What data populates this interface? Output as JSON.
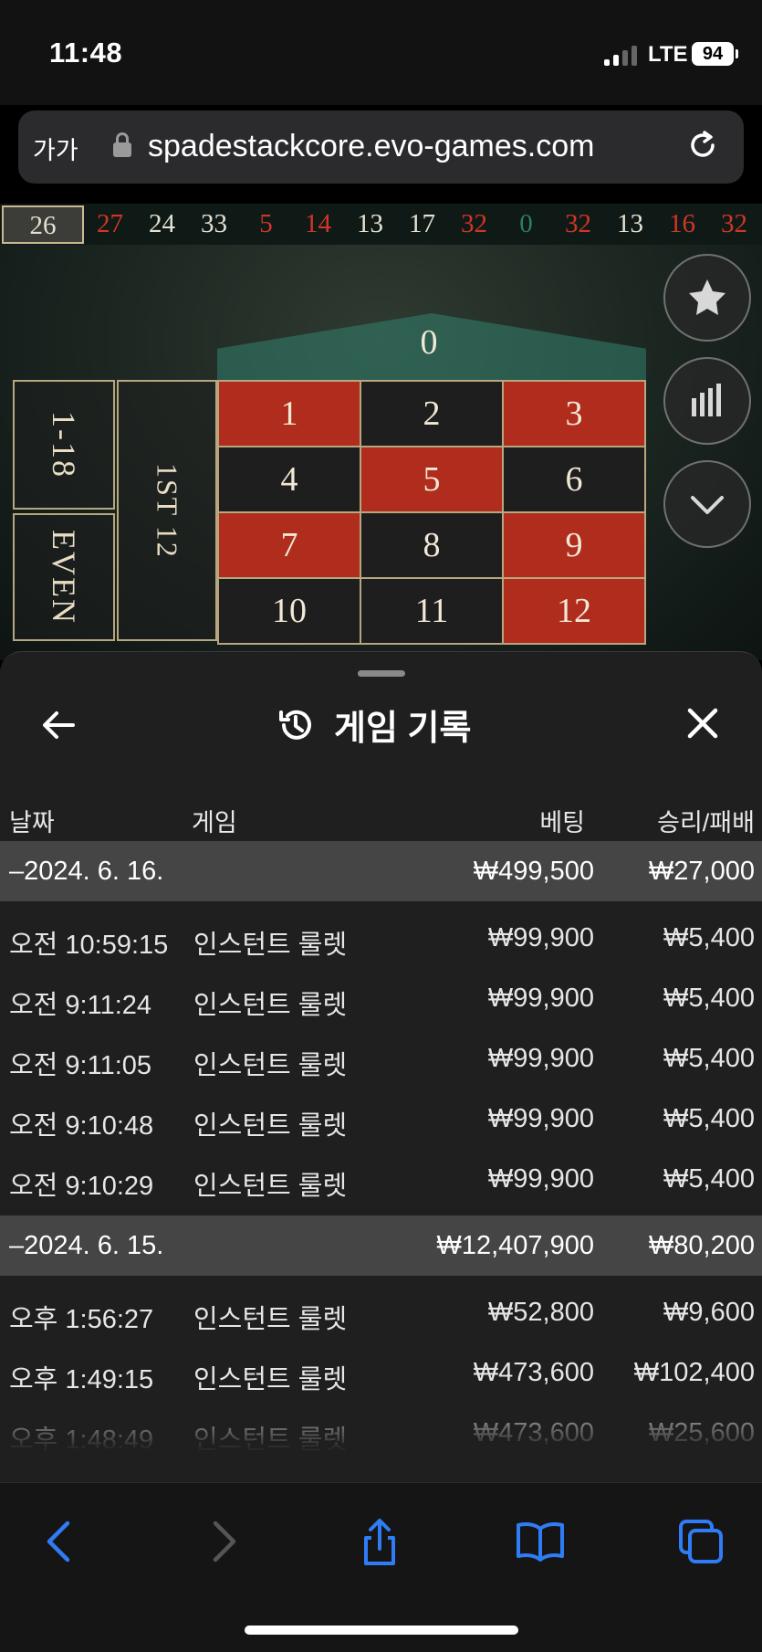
{
  "status_bar": {
    "time": "11:48",
    "network": "LTE",
    "battery": "94"
  },
  "browser": {
    "text_size_label": "가가",
    "url": "spadestackcore.evo-games.com"
  },
  "roulette": {
    "recent_results": [
      {
        "n": "26",
        "c": "black"
      },
      {
        "n": "27",
        "c": "red"
      },
      {
        "n": "24",
        "c": "black"
      },
      {
        "n": "33",
        "c": "black"
      },
      {
        "n": "5",
        "c": "red"
      },
      {
        "n": "14",
        "c": "red"
      },
      {
        "n": "13",
        "c": "black"
      },
      {
        "n": "17",
        "c": "black"
      },
      {
        "n": "32",
        "c": "red"
      },
      {
        "n": "0",
        "c": "green"
      },
      {
        "n": "32",
        "c": "red"
      },
      {
        "n": "13",
        "c": "black"
      },
      {
        "n": "16",
        "c": "red"
      },
      {
        "n": "32",
        "c": "red"
      }
    ],
    "zero_label": "0",
    "low_label": "1-18",
    "even_label": "EVEN",
    "dozen_label": "1ST 12",
    "cells": [
      {
        "n": "1",
        "c": "red"
      },
      {
        "n": "2",
        "c": "black"
      },
      {
        "n": "3",
        "c": "red"
      },
      {
        "n": "4",
        "c": "black"
      },
      {
        "n": "5",
        "c": "red"
      },
      {
        "n": "6",
        "c": "black"
      },
      {
        "n": "7",
        "c": "red"
      },
      {
        "n": "8",
        "c": "black"
      },
      {
        "n": "9",
        "c": "red"
      },
      {
        "n": "10",
        "c": "black"
      },
      {
        "n": "11",
        "c": "black"
      },
      {
        "n": "12",
        "c": "red"
      }
    ]
  },
  "history": {
    "title": "게임 기록",
    "columns": {
      "date": "날짜",
      "game": "게임",
      "bet": "베팅",
      "winloss": "승리/패배"
    },
    "groups": [
      {
        "date": "–2024. 6. 16.",
        "bet_total": "₩499,500",
        "win_total": "₩27,000",
        "rows": [
          {
            "time": "오전 10:59:15",
            "game": "인스턴트 룰렛",
            "bet": "₩99,900",
            "win": "₩5,400"
          },
          {
            "time": "오전 9:11:24",
            "game": "인스턴트 룰렛",
            "bet": "₩99,900",
            "win": "₩5,400"
          },
          {
            "time": "오전 9:11:05",
            "game": "인스턴트 룰렛",
            "bet": "₩99,900",
            "win": "₩5,400"
          },
          {
            "time": "오전 9:10:48",
            "game": "인스턴트 룰렛",
            "bet": "₩99,900",
            "win": "₩5,400"
          },
          {
            "time": "오전 9:10:29",
            "game": "인스턴트 룰렛",
            "bet": "₩99,900",
            "win": "₩5,400"
          }
        ]
      },
      {
        "date": "–2024. 6. 15.",
        "bet_total": "₩12,407,900",
        "win_total": "₩80,200",
        "rows": [
          {
            "time": "오후 1:56:27",
            "game": "인스턴트 룰렛",
            "bet": "₩52,800",
            "win": "₩9,600"
          },
          {
            "time": "오후 1:49:15",
            "game": "인스턴트 룰렛",
            "bet": "₩473,600",
            "win": "₩102,400"
          },
          {
            "time": "오후 1:48:49",
            "game": "인스턴트 룰렛",
            "bet": "₩473,600",
            "win": "₩25,600"
          }
        ]
      }
    ]
  },
  "colors": {
    "red": "#d23527",
    "board_red": "#b02c1c",
    "board_black": "#1e1e1e",
    "gold_border": "#b7a77f",
    "ios_blue": "#2f7cf6"
  }
}
